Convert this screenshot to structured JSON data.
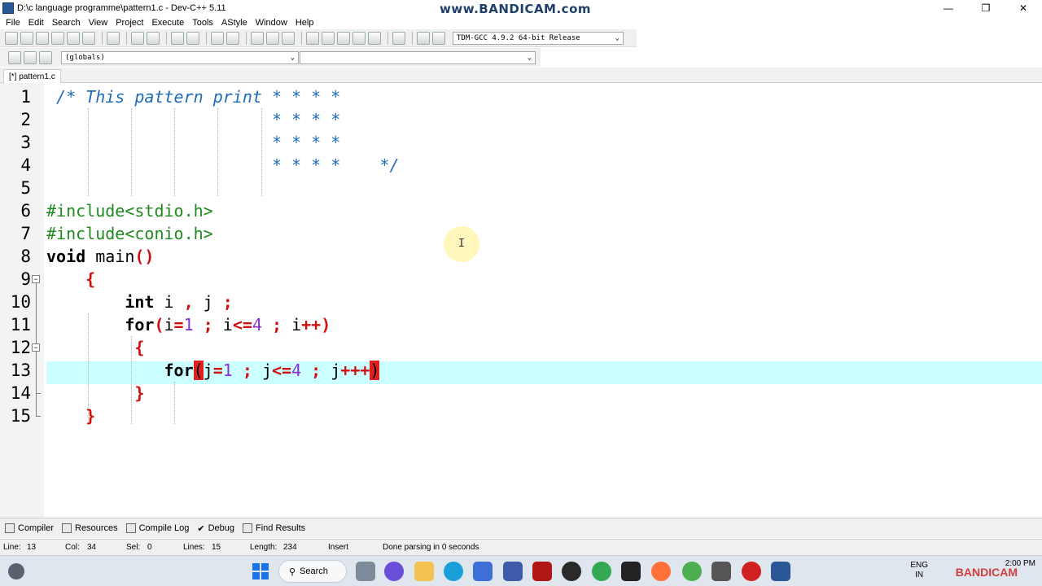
{
  "window": {
    "title": "D:\\c language programme\\pattern1.c - Dev-C++ 5.11",
    "watermark": "www.BANDICAM.com",
    "minimize": "—",
    "maximize": "❐",
    "close": "✕"
  },
  "menu": [
    "File",
    "Edit",
    "Search",
    "View",
    "Project",
    "Execute",
    "Tools",
    "AStyle",
    "Window",
    "Help"
  ],
  "toolbar": {
    "compiler": "TDM-GCC 4.9.2 64-bit Release",
    "scope": "(globals)",
    "symbol": ""
  },
  "tab": {
    "label": "[*] pattern1.c"
  },
  "editor": {
    "line_numbers": [
      "1",
      "2",
      "3",
      "4",
      "5",
      "6",
      "7",
      "8",
      "9",
      "10",
      "11",
      "12",
      "13",
      "14",
      "15"
    ],
    "lines": [
      [
        {
          "t": " /* This pattern print * * * *",
          "c": "cm"
        }
      ],
      [
        {
          "t": "                       * * * *",
          "c": "cm"
        }
      ],
      [
        {
          "t": "                       * * * *",
          "c": "cm"
        }
      ],
      [
        {
          "t": "                       * * * *    */",
          "c": "cm"
        }
      ],
      [],
      [
        {
          "t": "#include<stdio.h>",
          "c": "pp"
        }
      ],
      [
        {
          "t": "#include<conio.h>",
          "c": "pp"
        }
      ],
      [
        {
          "t": "void",
          "c": "kw"
        },
        {
          "t": " main",
          "c": "id"
        },
        {
          "t": "()",
          "c": "sy"
        }
      ],
      [
        {
          "t": "    ",
          "c": "id"
        },
        {
          "t": "{",
          "c": "sy"
        }
      ],
      [
        {
          "t": "        ",
          "c": "id"
        },
        {
          "t": "int",
          "c": "kw"
        },
        {
          "t": " i ",
          "c": "id"
        },
        {
          "t": ",",
          "c": "sy"
        },
        {
          "t": " j ",
          "c": "id"
        },
        {
          "t": ";",
          "c": "sy"
        }
      ],
      [
        {
          "t": "        ",
          "c": "id"
        },
        {
          "t": "for",
          "c": "kw"
        },
        {
          "t": "(",
          "c": "sy"
        },
        {
          "t": "i",
          "c": "id"
        },
        {
          "t": "=",
          "c": "sy"
        },
        {
          "t": "1",
          "c": "nm"
        },
        {
          "t": " ; ",
          "c": "sy"
        },
        {
          "t": "i",
          "c": "id"
        },
        {
          "t": "<=",
          "c": "sy"
        },
        {
          "t": "4",
          "c": "nm"
        },
        {
          "t": " ; ",
          "c": "sy"
        },
        {
          "t": "i",
          "c": "id"
        },
        {
          "t": "++)",
          "c": "sy"
        }
      ],
      [
        {
          "t": "         ",
          "c": "id"
        },
        {
          "t": "{",
          "c": "sy"
        }
      ],
      [
        {
          "t": "            ",
          "c": "id"
        },
        {
          "t": "for",
          "c": "kw"
        },
        {
          "t": "(",
          "c": "bm"
        },
        {
          "t": "j",
          "c": "id"
        },
        {
          "t": "=",
          "c": "sy"
        },
        {
          "t": "1",
          "c": "nm"
        },
        {
          "t": " ; ",
          "c": "sy"
        },
        {
          "t": "j",
          "c": "id"
        },
        {
          "t": "<=",
          "c": "sy"
        },
        {
          "t": "4",
          "c": "nm"
        },
        {
          "t": " ; ",
          "c": "sy"
        },
        {
          "t": "j",
          "c": "id"
        },
        {
          "t": "+++",
          "c": "sy"
        },
        {
          "t": ")",
          "c": "bm"
        }
      ],
      [
        {
          "t": "         ",
          "c": "id"
        },
        {
          "t": "}",
          "c": "sy"
        }
      ],
      [
        {
          "t": "    ",
          "c": "id"
        },
        {
          "t": "}",
          "c": "sy"
        }
      ]
    ]
  },
  "bottom_tabs": [
    "Compiler",
    "Resources",
    "Compile Log",
    "Debug",
    "Find Results"
  ],
  "status": {
    "line_label": "Line:",
    "line": "13",
    "col_label": "Col:",
    "col": "34",
    "sel_label": "Sel:",
    "sel": "0",
    "lines_label": "Lines:",
    "lines": "15",
    "length_label": "Length:",
    "length": "234",
    "mode": "Insert",
    "message": "Done parsing in 0 seconds"
  },
  "taskbar": {
    "search": "Search",
    "lang1": "ENG",
    "lang2": "IN",
    "time": "2:00 PM",
    "date": "",
    "recorder_label": "BANDICAM"
  },
  "colors": {
    "comment": "#1e6bb8",
    "preprocessor": "#1f8a1f",
    "symbol": "#d01010",
    "number": "#8a2be2",
    "current_line": "#ccffff"
  }
}
